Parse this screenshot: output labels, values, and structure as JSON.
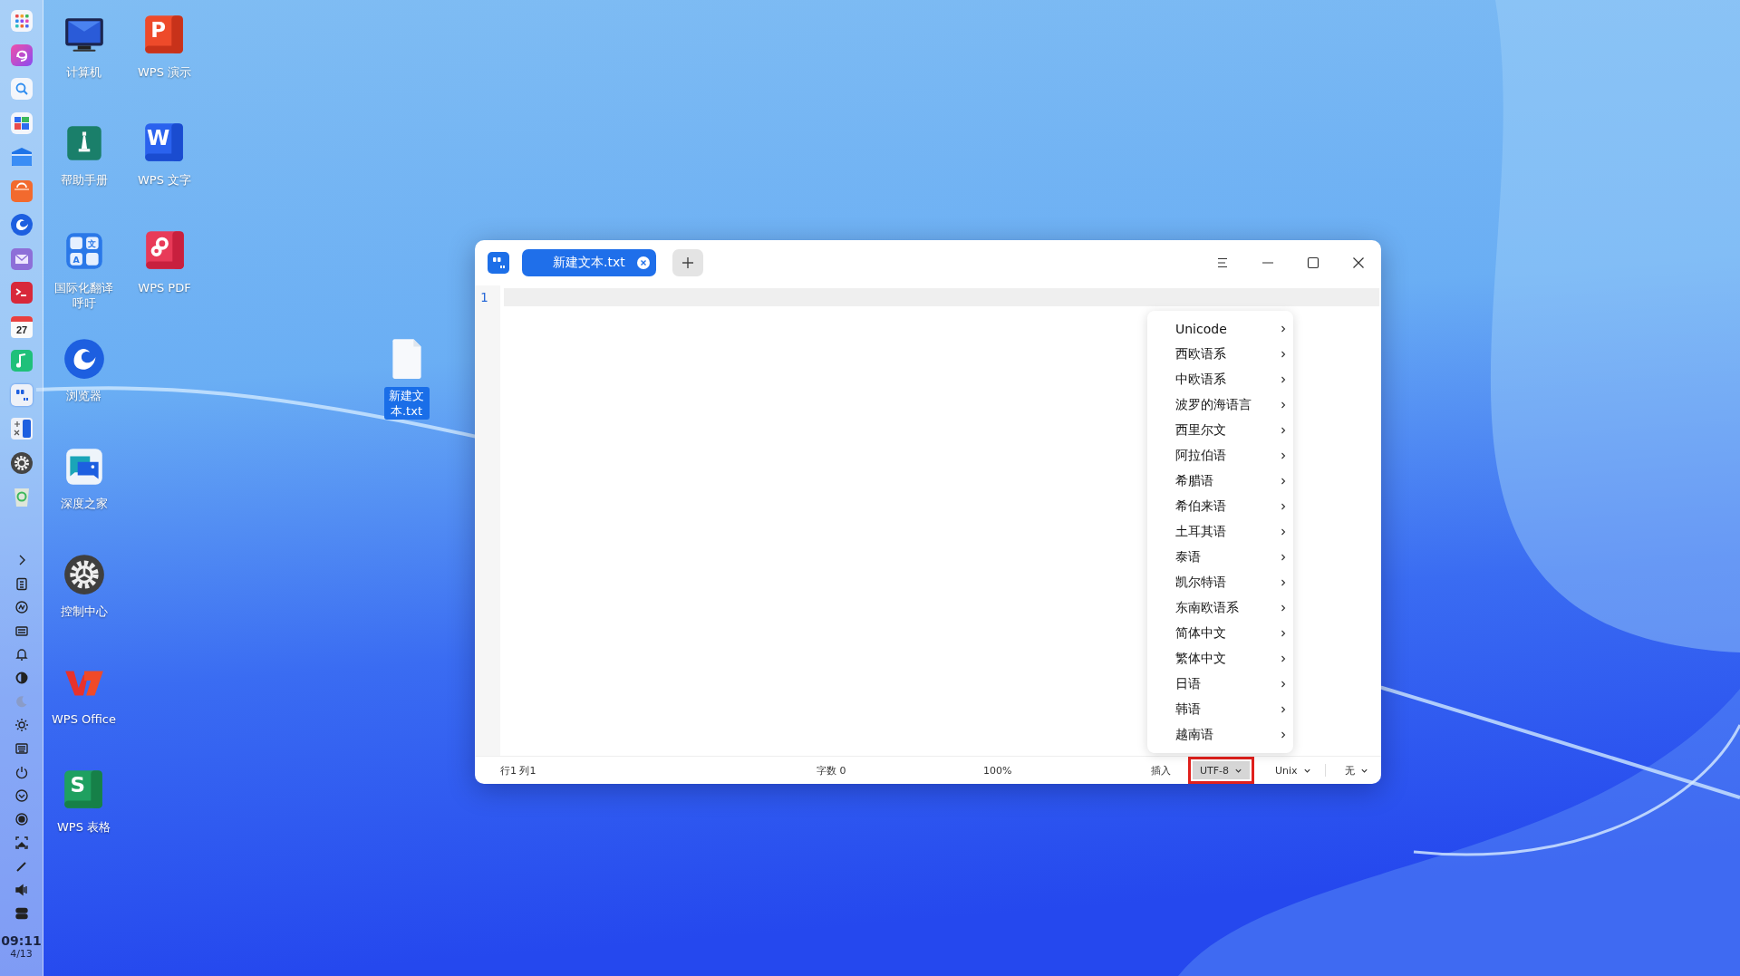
{
  "dock": {
    "apps": [
      {
        "running": false
      },
      {
        "running": false
      },
      {
        "running": false
      },
      {
        "running": false
      },
      {
        "running": false
      },
      {
        "running": false
      },
      {
        "running": false
      },
      {
        "running": false
      },
      {
        "running": false
      },
      {
        "running": false,
        "day": "27"
      },
      {
        "running": false
      },
      {
        "running": true
      },
      {
        "running": false
      },
      {
        "running": false
      },
      {
        "running": false
      }
    ],
    "time": "09:11",
    "date": "4/13"
  },
  "desktop": {
    "columns": [
      [
        {
          "label": "计算机",
          "selected": false
        },
        {
          "label": "帮助手册",
          "selected": false
        },
        {
          "label": "国际化翻译呼吁",
          "selected": false,
          "glyphs": [
            "文",
            "A"
          ]
        },
        {
          "label": "浏览器",
          "selected": false
        },
        {
          "label": "深度之家",
          "selected": false
        },
        {
          "label": "控制中心",
          "selected": false
        },
        {
          "label": "WPS Office",
          "selected": false
        },
        {
          "label": "WPS 表格",
          "selected": false,
          "glyphs": [
            "S"
          ]
        }
      ],
      [
        {
          "label": "WPS 演示",
          "selected": false,
          "glyphs": [
            "P"
          ]
        },
        {
          "label": "WPS 文字",
          "selected": false,
          "glyphs": [
            "W"
          ]
        },
        {
          "label": "WPS PDF",
          "selected": false
        }
      ]
    ],
    "files": [
      {
        "label": "新建文本.txt",
        "selected": true
      }
    ]
  },
  "window": {
    "tab": {
      "label": "新建文本.txt",
      "selected": true
    },
    "line_numbers": [
      "1"
    ],
    "encoding_menu": {
      "items": [
        {
          "label": "Unicode"
        },
        {
          "label": "西欧语系"
        },
        {
          "label": "中欧语系"
        },
        {
          "label": "波罗的海语言"
        },
        {
          "label": "西里尔文"
        },
        {
          "label": "阿拉伯语"
        },
        {
          "label": "希腊语"
        },
        {
          "label": "希伯来语"
        },
        {
          "label": "土耳其语"
        },
        {
          "label": "泰语"
        },
        {
          "label": "凯尔特语"
        },
        {
          "label": "东南欧语系"
        },
        {
          "label": "简体中文"
        },
        {
          "label": "繁体中文"
        },
        {
          "label": "日语"
        },
        {
          "label": "韩语"
        },
        {
          "label": "越南语"
        }
      ]
    },
    "status_bar": {
      "position": "行1 列1",
      "word_count": "字数 0",
      "zoom": "100%",
      "mode": "插入",
      "dropdowns": [
        {
          "label": "UTF-8",
          "active": true,
          "annotated": true
        },
        {
          "label": "Unix",
          "active": false,
          "annotated": false
        },
        {
          "label": "无",
          "active": false,
          "annotated": false
        }
      ]
    }
  }
}
